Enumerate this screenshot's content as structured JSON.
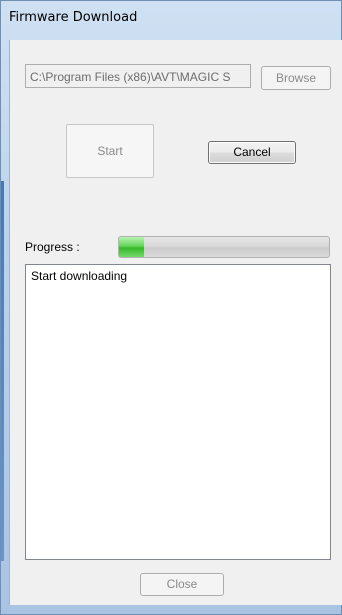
{
  "window": {
    "title": "Firmware Download"
  },
  "form": {
    "path_value": "C:\\Program Files (x86)\\AVT\\MAGIC S",
    "browse_label": "Browse",
    "start_label": "Start",
    "cancel_label": "Cancel",
    "close_label": "Close"
  },
  "progress": {
    "label": "Progress :",
    "fraction": 0.12,
    "fill_color": "#37b82a"
  },
  "log": {
    "lines": [
      "Start downloading"
    ]
  },
  "colors": {
    "frame": "#a9c4e3",
    "client": "#f0f0f0"
  }
}
